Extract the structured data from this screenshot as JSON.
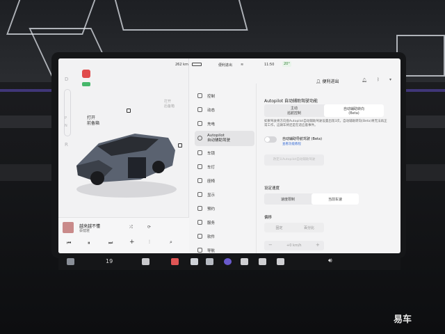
{
  "status_bar": {
    "range": "262 km",
    "profile": "便利进出",
    "time": "11:50",
    "temperature": "20°",
    "temp_badge_color": "#4caf50"
  },
  "header": {
    "profile_label": "便利进出"
  },
  "car_panel": {
    "gears": [
      "D",
      "P",
      "N",
      "R"
    ],
    "open_frunk_line1": "打开",
    "open_frunk_line2": "前备箱",
    "open_trunk": "打开\n后备箱"
  },
  "music": {
    "song_title": "越来越不懂",
    "artist": "蔡健雅"
  },
  "menu": {
    "items": [
      {
        "label": "控制",
        "icon": "toggle-icon"
      },
      {
        "label": "动态",
        "icon": "car-icon"
      },
      {
        "label": "充电",
        "icon": "bolt-icon"
      },
      {
        "label": "Autopilot",
        "sublabel": "自动辅助驾驶",
        "icon": "steering-wheel-icon"
      },
      {
        "label": "车锁",
        "icon": "lock-icon"
      },
      {
        "label": "车灯",
        "icon": "light-icon"
      },
      {
        "label": "座椅",
        "icon": "seat-icon"
      },
      {
        "label": "显示",
        "icon": "display-icon"
      },
      {
        "label": "预约",
        "icon": "clock-icon"
      },
      {
        "label": "服务",
        "icon": "wrench-icon"
      },
      {
        "label": "软件",
        "icon": "download-icon"
      },
      {
        "label": "导航",
        "icon": "navigation-icon"
      },
      {
        "label": "安全",
        "icon": "shield-icon"
      }
    ]
  },
  "autopilot": {
    "section_title": "Autopilot 自动辅助驾驶功能",
    "option1_line1": "主动",
    "option1_line2": "巡航控制",
    "option2_line1": "自动辅助转向",
    "option2_line2": "(Beta)",
    "description": "如果驾驶将方向盘Autopilot自动辅助驾驶设置出现3次，自动辅助转向(Beta)将无法再正常工作，这辆车将还是在适应着事件。",
    "nav_toggle_label": "自动辅助导航驾驶 (Beta)",
    "nav_toggle_link": "查看功能教程",
    "disabled_button": "改定义Autopilot自动辅助驾驶",
    "speed_limit_title": "设定速度",
    "speed_opt1": "速度限制",
    "speed_opt2": "当前车速",
    "offset_title": "偏移",
    "offset_opt1": "固定",
    "offset_opt2": "百分比",
    "offset_value": "+0 km/h",
    "offset_minus": "−",
    "offset_plus": "+"
  },
  "taskbar": {
    "temperature": "19",
    "volume_icon": "volume-icon"
  },
  "watermark": "易车"
}
